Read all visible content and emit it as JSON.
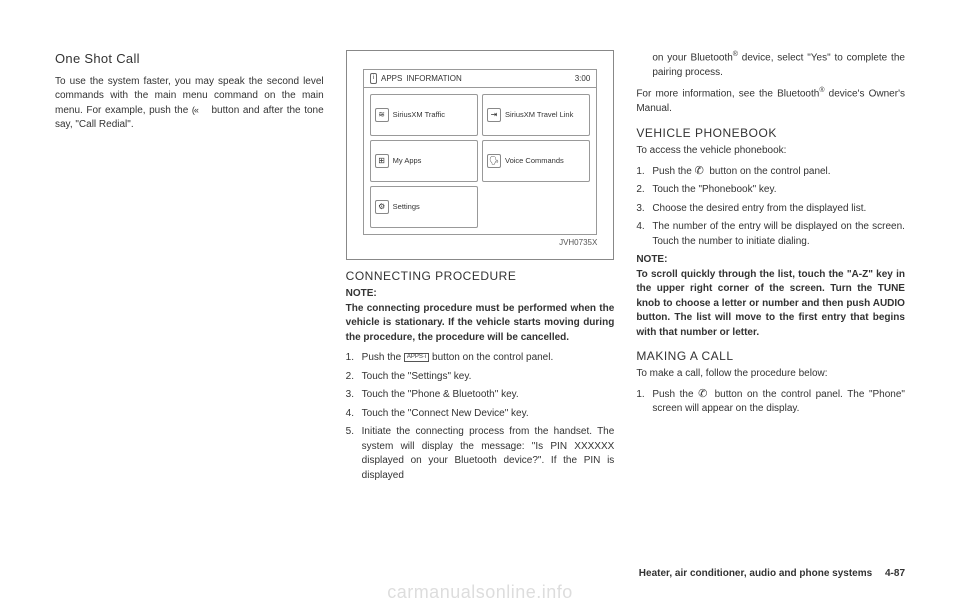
{
  "col1": {
    "heading": "One Shot Call",
    "para_a": "To use the system faster, you may speak the second level commands with the main menu command on the main menu. For example, push the ",
    "para_b": " button and after the tone say, \"Call Redial\"."
  },
  "figure": {
    "top_badge": "i",
    "top_apps": "APPS",
    "top_info": "INFORMATION",
    "top_time": "3:00",
    "cells": {
      "traffic": "SiriusXM Traffic",
      "travel": "SiriusXM Travel Link",
      "myapps": "My Apps",
      "voice": "Voice Commands",
      "settings": "Settings"
    },
    "id": "JVH0735X"
  },
  "col2": {
    "heading": "CONNECTING PROCEDURE",
    "note_label": "NOTE:",
    "note_body": "The connecting procedure must be performed when the vehicle is stationary. If the vehicle starts moving during the procedure, the procedure will be cancelled.",
    "steps": {
      "s1a": "Push the ",
      "s1b": " button on the control panel.",
      "s2": "Touch the \"Settings\" key.",
      "s3": "Touch the \"Phone & Bluetooth\" key.",
      "s4": "Touch the \"Connect New Device\" key.",
      "s5": "Initiate the connecting process from the handset. The system will display the message: \"Is PIN XXXXXX displayed on your Bluetooth device?\". If the PIN is displayed"
    }
  },
  "col3": {
    "cont_a": "on your Bluetooth",
    "cont_b": " device, select \"Yes\" to complete the pairing process.",
    "more_a": "For more information, see the Bluetooth",
    "more_b": " device's Owner's Manual.",
    "heading_pb": "VEHICLE PHONEBOOK",
    "access": "To access the vehicle phonebook:",
    "pb_steps": {
      "s1a": "Push the ",
      "s1b": " button on the control panel.",
      "s2": "Touch the \"Phonebook\" key.",
      "s3": "Choose the desired entry from the displayed list.",
      "s4": "The number of the entry will be displayed on the screen. Touch the number to initiate dialing."
    },
    "note_label": "NOTE:",
    "note_body": "To scroll quickly through the list, touch the \"A-Z\" key in the upper right corner of the screen. Turn the TUNE knob to choose a letter or number and then push AUDIO button. The list will move to the first entry that begins with that number or letter.",
    "heading_call": "MAKING A CALL",
    "call_intro": "To make a call, follow the procedure below:",
    "call_s1a": "Push the ",
    "call_s1b": " button on the control panel. The \"Phone\" screen will appear on the display."
  },
  "footer": {
    "section": "Heater, air conditioner, audio and phone systems",
    "page": "4-87"
  },
  "watermark": "carmanualsonline.info",
  "reg": "®"
}
